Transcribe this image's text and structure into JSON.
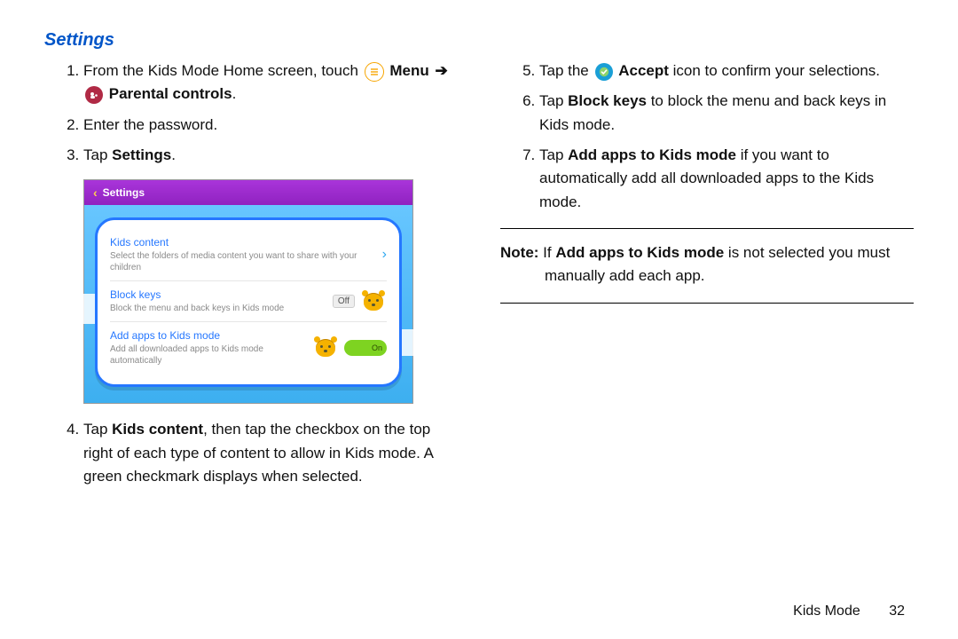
{
  "heading": "Settings",
  "left_steps": {
    "s1a": "From the Kids Mode Home screen, touch",
    "s1_menu": "Menu",
    "s1_arrow": "➔",
    "s1_parental": "Parental controls",
    "s2": "Enter the password.",
    "s3a": "Tap ",
    "s3b": "Settings",
    "s4a": "Tap ",
    "s4b": "Kids content",
    "s4c": ", then tap the checkbox on the top right of each type of content to allow in Kids mode. A green checkmark displays when selected."
  },
  "right_steps": {
    "s5a": "Tap the",
    "s5b": "Accept",
    "s5c": " icon to confirm your selections.",
    "s6a": "Tap ",
    "s6b": "Block keys",
    "s6c": " to block the menu and back keys in Kids mode.",
    "s7a": "Tap ",
    "s7b": "Add apps to Kids mode",
    "s7c": " if you want to automatically add all downloaded apps to the Kids mode."
  },
  "note": {
    "label": "Note:",
    "part_if": " If ",
    "bold": "Add apps to Kids mode",
    "tail1": " is not selected you must",
    "tail2": "manually add each app."
  },
  "screenshot": {
    "title": "Settings",
    "rows": [
      {
        "title": "Kids content",
        "desc": "Select the folders of media content you want to share with your children",
        "control": "chevron"
      },
      {
        "title": "Block keys",
        "desc": "Block the menu and back keys in Kids mode",
        "control": "off",
        "off_label": "Off"
      },
      {
        "title": "Add apps to Kids mode",
        "desc": "Add all downloaded apps to Kids mode automatically",
        "control": "on",
        "on_label": "On"
      }
    ]
  },
  "footer": {
    "section": "Kids Mode",
    "page": "32"
  }
}
